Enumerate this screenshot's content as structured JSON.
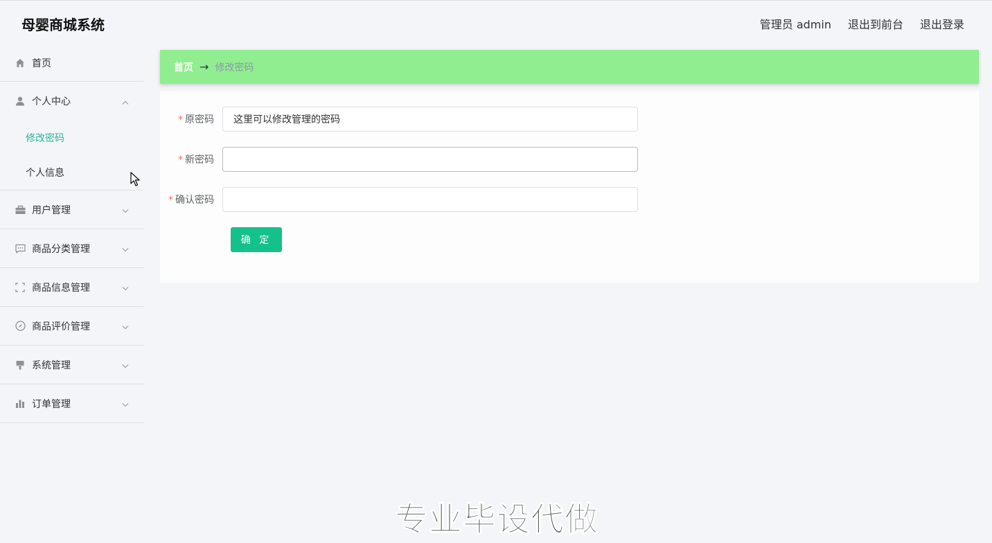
{
  "app": {
    "title": "母婴商城系统"
  },
  "header": {
    "admin_label": "管理员 admin",
    "to_front": "退出到前台",
    "logout": "退出登录"
  },
  "sidebar": {
    "home": {
      "label": "首页",
      "icon": "home-icon"
    },
    "personal": {
      "label": "个人中心",
      "icon": "user-icon",
      "expanded": true,
      "children": [
        {
          "label": "修改密码",
          "active": true
        },
        {
          "label": "个人信息",
          "active": false
        }
      ]
    },
    "groups": [
      {
        "label": "用户管理",
        "icon": "briefcase-icon"
      },
      {
        "label": "商品分类管理",
        "icon": "chat-icon"
      },
      {
        "label": "商品信息管理",
        "icon": "fullscreen-icon"
      },
      {
        "label": "商品评价管理",
        "icon": "compass-icon"
      },
      {
        "label": "系统管理",
        "icon": "brush-icon"
      },
      {
        "label": "订单管理",
        "icon": "bar-chart-icon"
      }
    ]
  },
  "breadcrumb": {
    "home": "首页",
    "separator": "→",
    "current": "修改密码"
  },
  "form": {
    "old_password": {
      "label": "原密码",
      "value": "这里可以修改管理的密码"
    },
    "new_password": {
      "label": "新密码",
      "value": ""
    },
    "confirm_password": {
      "label": "确认密码",
      "value": ""
    },
    "submit": "确 定"
  },
  "watermark": "专业毕设代做",
  "colors": {
    "breadcrumb_bg": "#90ee90",
    "active_menu": "#2bb597",
    "button": "#14c18a",
    "required": "#f56c6c"
  }
}
